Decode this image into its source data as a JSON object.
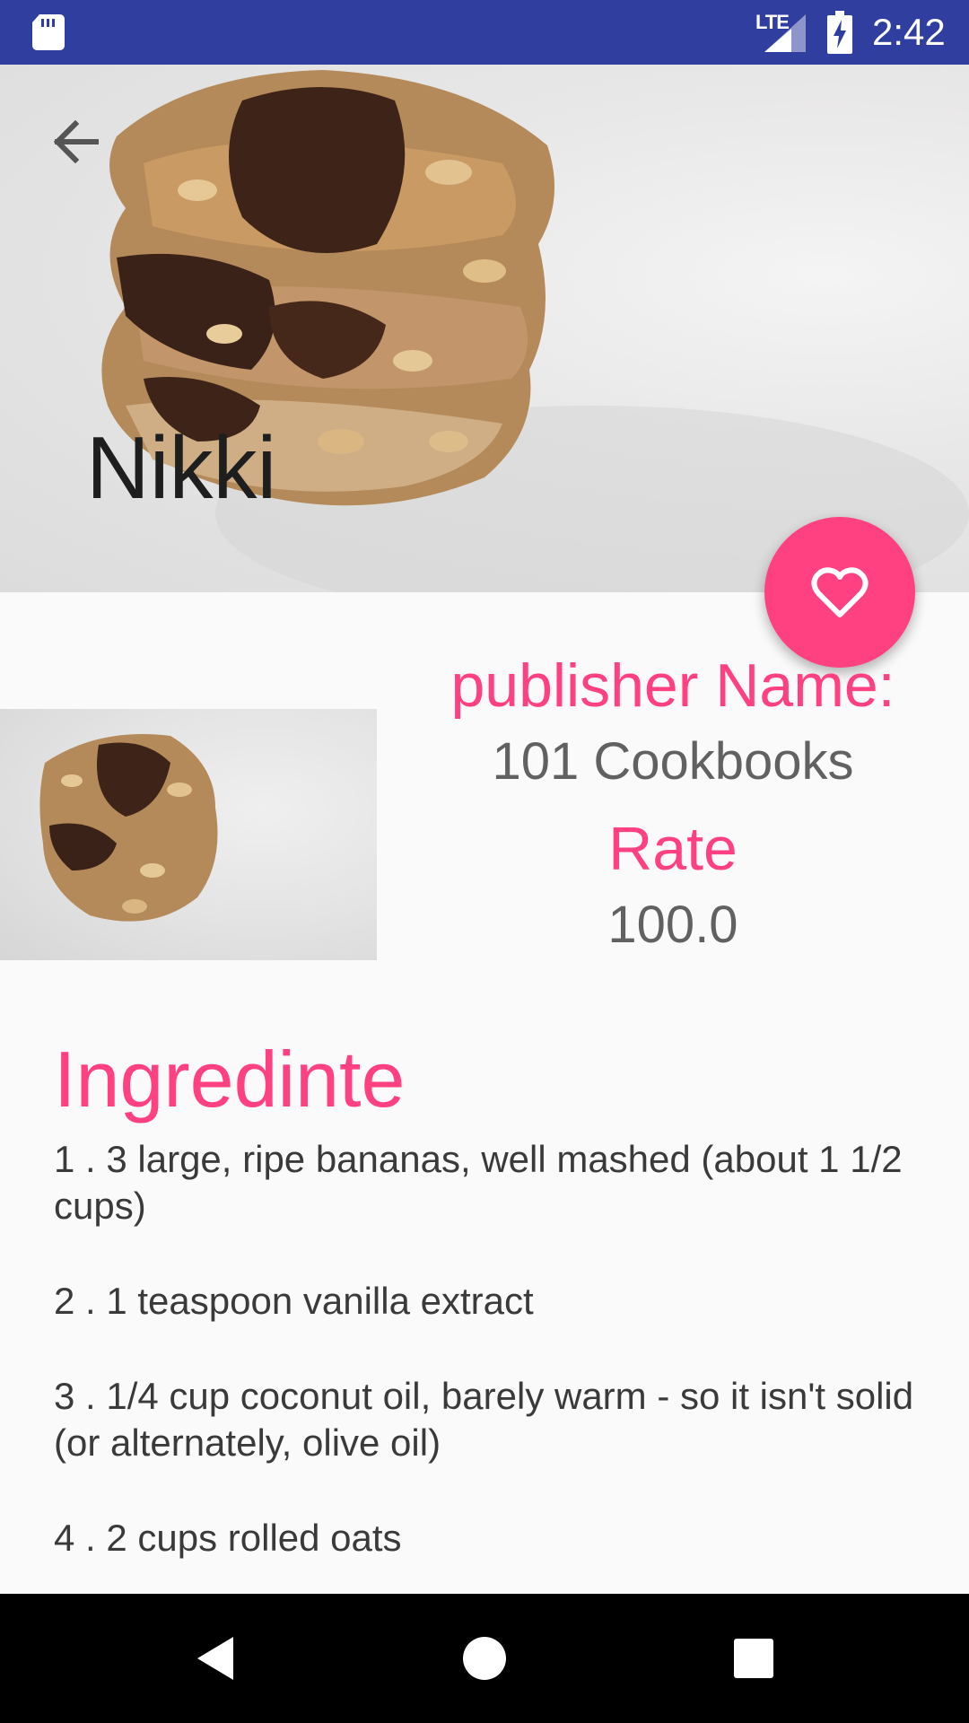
{
  "status_bar": {
    "network": "LTE",
    "time": "2:42"
  },
  "header": {
    "title": "Nikki"
  },
  "publisher": {
    "label": "publisher Name:",
    "value": "101 Cookbooks"
  },
  "rate": {
    "label": "Rate",
    "value": "100.0"
  },
  "ingredients": {
    "title": "Ingredinte",
    "items": [
      "1 . 3 large, ripe bananas, well mashed (about 1 1/2 cups)",
      "2 . 1 teaspoon vanilla extract",
      "3 . 1/4 cup coconut oil, barely warm - so it isn't solid (or alternately, olive oil)",
      "4 . 2 cups rolled oats"
    ]
  },
  "colors": {
    "accent": "#ff4081",
    "status_bar": "#303f9f",
    "text_primary": "#1e1e1e",
    "text_secondary": "#616161"
  },
  "icons": {
    "back": "arrow-back-icon",
    "favorite": "heart-outline-icon",
    "nav_back": "triangle-back-icon",
    "nav_home": "circle-home-icon",
    "nav_recents": "square-recents-icon"
  }
}
